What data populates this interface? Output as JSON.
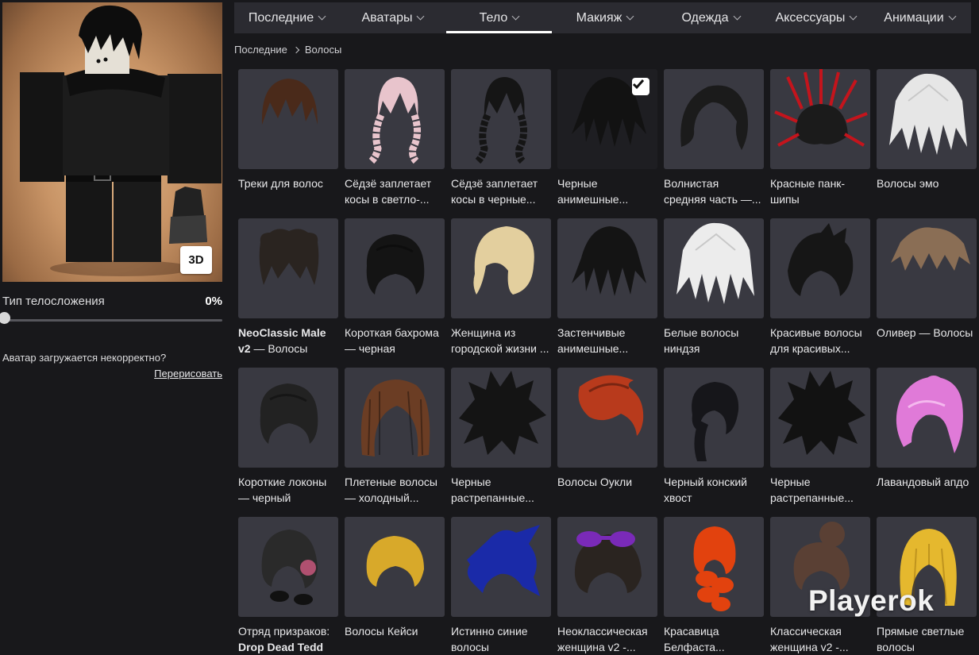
{
  "tabs": [
    {
      "label": "Последние",
      "active": false
    },
    {
      "label": "Аватары",
      "active": false
    },
    {
      "label": "Тело",
      "active": true
    },
    {
      "label": "Макияж",
      "active": false
    },
    {
      "label": "Одежда",
      "active": false
    },
    {
      "label": "Аксессуары",
      "active": false
    },
    {
      "label": "Анимации",
      "active": false
    }
  ],
  "breadcrumb": {
    "parent": "Последние",
    "current": "Волосы"
  },
  "avatar_panel": {
    "button_3d": "3D",
    "body_type_label": "Тип телосложения",
    "body_type_value": "0%",
    "body_type_fraction": 0,
    "broken_text": "Аватар загружается некорректно?",
    "redraw_link": "Перерисовать"
  },
  "items": [
    {
      "name": "Треки для волос",
      "icon": "brown-bowl-hair",
      "color": "#4a2a1a"
    },
    {
      "name": "Сёдзё заплетает косы в светло-...",
      "icon": "pink-braids-hair",
      "color": "#e8c4cc"
    },
    {
      "name": "Сёдзё заплетает косы в черные...",
      "icon": "black-braids-hair",
      "color": "#151515"
    },
    {
      "name": "Черные анимешные...",
      "icon": "black-anime-hair",
      "color": "#121212",
      "selected": true
    },
    {
      "name": "Волнистая средняя часть —...",
      "icon": "black-wavy-hair",
      "color": "#1b1b1b"
    },
    {
      "name": "Красные панк-шипы",
      "icon": "red-punk-spikes-hair",
      "color": "#c4141c"
    },
    {
      "name": "Волосы эмо",
      "icon": "white-emo-hair",
      "color": "#e6e6e6"
    },
    {
      "name": "NeoClassic Male v2 — Волосы",
      "bold_part": "NeoClassic Male v2",
      "icon": "dark-curly-hair",
      "color": "#2a2420"
    },
    {
      "name": "Короткая бахрома — черная",
      "icon": "black-short-hair",
      "color": "#141414"
    },
    {
      "name": "Женщина из городской жизни ...",
      "icon": "blonde-bob-hair",
      "color": "#e3cf9e"
    },
    {
      "name": "Застенчивые анимешные...",
      "icon": "black-shy-anime-hair",
      "color": "#141414"
    },
    {
      "name": "Белые волосы ниндзя",
      "icon": "white-ninja-hair",
      "color": "#ececec"
    },
    {
      "name": "Красивые волосы для красивых...",
      "icon": "black-messy-hair",
      "color": "#161616"
    },
    {
      "name": "Оливер — Волосы",
      "icon": "brown-messy-hair",
      "color": "#8a6e55"
    },
    {
      "name": "Короткие локоны — черный",
      "icon": "black-curls-hair",
      "color": "#222222"
    },
    {
      "name": "Плетеные волосы — холодный...",
      "icon": "brown-braided-hair",
      "color": "#6b3d24"
    },
    {
      "name": "Черные растрепанные...",
      "icon": "black-spiky-hair",
      "color": "#141414"
    },
    {
      "name": "Волосы Оукли",
      "icon": "red-swoop-hair",
      "color": "#b83a1c"
    },
    {
      "name": "Черный конский хвост",
      "icon": "black-ponytail-hair",
      "color": "#16161a"
    },
    {
      "name": "Черные растрепанные...",
      "icon": "black-shaggy-hair",
      "color": "#121212"
    },
    {
      "name": "Лавандовый апдо",
      "icon": "lavender-updo-hair",
      "color": "#e07ad8"
    },
    {
      "name": "Отряд призраков: Drop Dead Tedd -...",
      "bold_part": "Drop Dead Tedd -...",
      "icon": "ghost-squad-hair",
      "color": "#2a2a2a"
    },
    {
      "name": "Волосы Кейси",
      "icon": "blonde-short-hair",
      "color": "#d8a92a"
    },
    {
      "name": "Истинно синие волосы",
      "icon": "blue-hair",
      "color": "#1a2aa8"
    },
    {
      "name": "Неоклассическая женщина v2 -...",
      "icon": "hair-with-purple-glasses",
      "color": "#2a2420"
    },
    {
      "name": "Красавица Белфаста...",
      "icon": "orange-braided-hair",
      "color": "#e2420e"
    },
    {
      "name": "Классическая женщина v2 -...",
      "icon": "brown-bun-hair",
      "color": "#5a4034"
    },
    {
      "name": "Прямые светлые волосы",
      "icon": "blonde-long-hair",
      "color": "#e5b82e"
    }
  ],
  "watermark": "Playerok"
}
